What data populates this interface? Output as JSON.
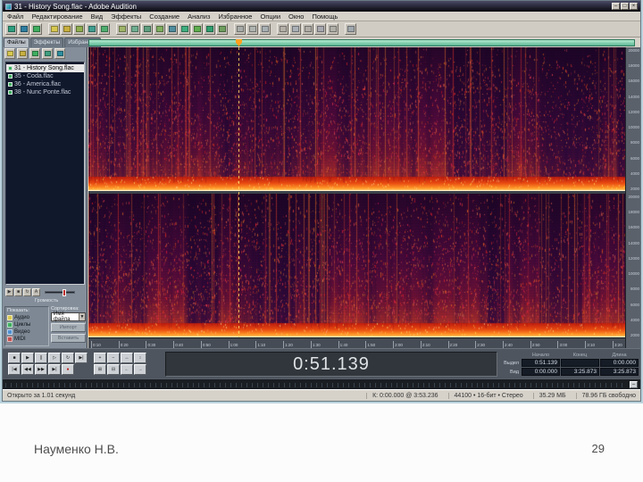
{
  "window": {
    "title": "31 - History Song.flac - Adobe Audition",
    "buttons": [
      "–",
      "□",
      "×"
    ]
  },
  "menu": {
    "items": [
      "Файл",
      "Редактирование",
      "Вид",
      "Эффекты",
      "Создание",
      "Анализ",
      "Избранное",
      "Опции",
      "Окно",
      "Помощь"
    ]
  },
  "toolbar": {
    "buttons": [
      {
        "n": "waveform-view-icon",
        "c": "#2e9e7e"
      },
      {
        "n": "multitrack-view-icon",
        "c": "#2e7ea0"
      },
      {
        "n": "cd-project-view-icon",
        "c": "#3fae5f"
      },
      {
        "n": "open-file-icon",
        "c": "#d8c850",
        "sep": true
      },
      {
        "n": "save-file-icon",
        "c": "#c8b040"
      },
      {
        "n": "undo-icon",
        "c": "#8fae4f"
      },
      {
        "n": "redo-icon",
        "c": "#3f9e8f"
      },
      {
        "n": "copy-icon",
        "c": "#4fae6f"
      },
      {
        "n": "cut-icon",
        "c": "#9fb468",
        "sep": true
      },
      {
        "n": "paste-icon",
        "c": "#6fae8f"
      },
      {
        "n": "mix-paste-icon",
        "c": "#5f9e7f"
      },
      {
        "n": "crop-icon",
        "c": "#7fae5f"
      },
      {
        "n": "delete-icon",
        "c": "#4f8e9f"
      },
      {
        "n": "convert-type-icon",
        "c": "#3fae7f"
      },
      {
        "n": "effects-rack-icon",
        "c": "#5fae4f"
      },
      {
        "n": "mixer-icon",
        "c": "#2f9e6f"
      },
      {
        "n": "loop-icon",
        "c": "#6f9e5f"
      },
      {
        "n": "snap-icon",
        "c": "#a8aca8",
        "sep": true
      },
      {
        "n": "group-icon",
        "c": "#b0b4b0"
      },
      {
        "n": "lock-icon",
        "c": "#a8b0b4"
      },
      {
        "n": "zoom-tool-icon",
        "c": "#b4b0a8",
        "sep": true
      },
      {
        "n": "time-selection-icon",
        "c": "#aab0b6"
      },
      {
        "n": "marquee-selection-icon",
        "c": "#b0aca6"
      },
      {
        "n": "lasso-selection-icon",
        "c": "#a8a8b0"
      },
      {
        "n": "scrub-tool-icon",
        "c": "#b0b0a8"
      },
      {
        "n": "options-icon",
        "c": "#a0a8ae",
        "sep": true
      }
    ]
  },
  "left_panel": {
    "tabs": [
      {
        "label": "Файлы",
        "active": true
      },
      {
        "label": "Эффекты",
        "active": false
      },
      {
        "label": "Избранное",
        "active": false
      }
    ],
    "tool_icons": [
      {
        "n": "import-file-icon",
        "c": "#d8c850"
      },
      {
        "n": "close-file-icon",
        "c": "#c8b040"
      },
      {
        "n": "insert-multitrack-icon",
        "c": "#3fae5f"
      },
      {
        "n": "insert-cd-icon",
        "c": "#3f9e7f"
      },
      {
        "n": "options-toggle-icon",
        "c": "#2e8e9e"
      }
    ],
    "files": [
      {
        "label": "31 - History Song.flac",
        "selected": true
      },
      {
        "label": "35 - Coda.flac",
        "selected": false
      },
      {
        "label": "36 - America.flac",
        "selected": false
      },
      {
        "label": "38 - Nunc Ponte.flac",
        "selected": false
      }
    ],
    "volume_label": "Громкость",
    "show_title": "Показать:",
    "filters": [
      {
        "label": "Аудио",
        "c": "#d8c850"
      },
      {
        "label": "Циклы",
        "c": "#3fae5f"
      },
      {
        "label": "Видео",
        "c": "#4f8fd0"
      },
      {
        "label": "MIDI",
        "c": "#c05050"
      }
    ],
    "sort_label": "Сортировка:",
    "sort_value": "Имя файла",
    "action_buttons": [
      {
        "label": "Импорт"
      },
      {
        "label": "Вставить"
      }
    ]
  },
  "spectrogram": {
    "channels": 2,
    "freq_ticks": [
      "20000",
      "18000",
      "16000",
      "14000",
      "12000",
      "10000",
      "8000",
      "6000",
      "4000",
      "2000"
    ],
    "colors": {
      "bg_top": "#1b0526",
      "bg_bottom": "#3a0a40",
      "streak": "#c81e32",
      "hot": "#ff6a20",
      "band": "#ff9828",
      "band_hi": "#ffd878",
      "playhead": "#ffd860"
    }
  },
  "timeline": {
    "ticks": [
      "0:10",
      "0:20",
      "0:30",
      "0:40",
      "0:50",
      "1:00",
      "1:10",
      "1:20",
      "1:30",
      "1:40",
      "1:50",
      "2:00",
      "2:10",
      "2:20",
      "2:30",
      "2:40",
      "2:50",
      "3:00",
      "3:10",
      "3:20"
    ]
  },
  "transport": {
    "row1": [
      {
        "n": "stop-button",
        "g": "■"
      },
      {
        "n": "play-button",
        "g": "▶"
      },
      {
        "n": "pause-button",
        "g": "||"
      },
      {
        "n": "play-from-cursor-button",
        "g": "▷"
      },
      {
        "n": "play-looped-button",
        "g": "↻"
      },
      {
        "n": "skip-button",
        "g": "▶|"
      }
    ],
    "row2": [
      {
        "n": "go-to-beginning-button",
        "g": "|◀"
      },
      {
        "n": "rewind-button",
        "g": "◀◀"
      },
      {
        "n": "fast-forward-button",
        "g": "▶▶"
      },
      {
        "n": "go-to-end-button",
        "g": "▶|"
      },
      {
        "n": "record-button",
        "g": "●",
        "c": "#c01818"
      }
    ]
  },
  "zoom_controls": {
    "row1": [
      {
        "n": "zoom-in-button",
        "g": "+"
      },
      {
        "n": "zoom-out-button",
        "g": "−"
      },
      {
        "n": "zoom-horizontal-button",
        "g": "↔"
      },
      {
        "n": "zoom-vertical-button",
        "g": "↕"
      }
    ],
    "row2": [
      {
        "n": "zoom-in-full-button",
        "g": "⊞"
      },
      {
        "n": "zoom-out-full-button",
        "g": "⊟"
      },
      {
        "n": "zoom-left-button",
        "g": "←"
      },
      {
        "n": "zoom-right-button",
        "g": "→"
      }
    ]
  },
  "time_display": "0:51.139",
  "selection_panel": {
    "headers": [
      "Начало",
      "Конец",
      "Длина"
    ],
    "rows": [
      {
        "label": "Выдел",
        "v1": "0:51.139",
        "v2": "",
        "v3": "0:00.000"
      },
      {
        "label": "Вид",
        "v1": "0:00.000",
        "v2": "3:25.873",
        "v3": "3:25.873"
      }
    ]
  },
  "overview_bar": {
    "handle_glyph": "–"
  },
  "status_bar": {
    "left": "Открыто за 1.01 секунд",
    "segments": [
      "К: 0:00.000 @ 3:53.236",
      "44100 • 16-бит • Стерео",
      "35.29 МБ",
      "78.96 ГБ свободно"
    ]
  },
  "slide": {
    "author": "Науменко Н.В.",
    "page": "29"
  }
}
